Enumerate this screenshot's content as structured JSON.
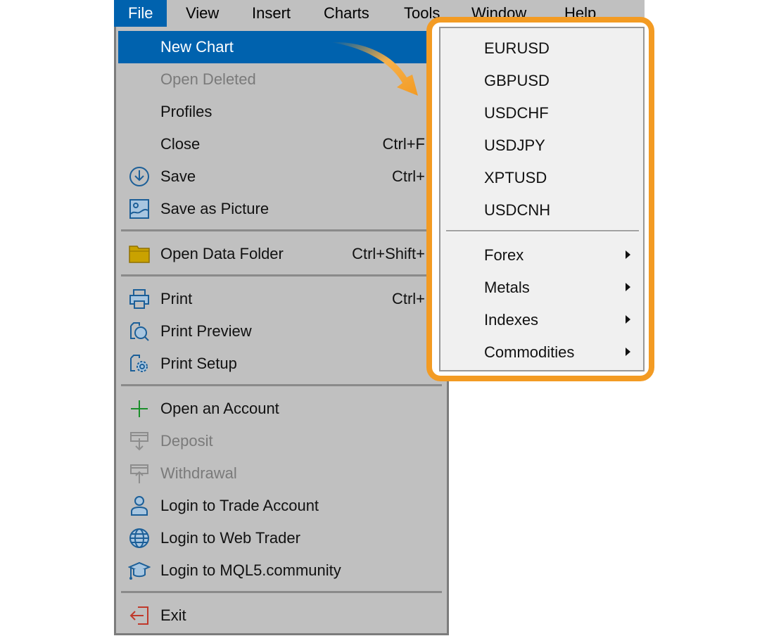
{
  "menubar": {
    "items": [
      {
        "label": "File",
        "active": true
      },
      {
        "label": "View"
      },
      {
        "label": "Insert"
      },
      {
        "label": "Charts"
      },
      {
        "label": "Tools"
      },
      {
        "label": "Window"
      },
      {
        "label": "Help"
      }
    ]
  },
  "file_menu": {
    "items": [
      {
        "label": "New Chart",
        "icon": "none",
        "highlighted": true
      },
      {
        "label": "Open Deleted",
        "icon": "none",
        "disabled": true
      },
      {
        "label": "Profiles",
        "icon": "none"
      },
      {
        "label": "Close",
        "icon": "none",
        "shortcut": "Ctrl+F"
      },
      {
        "label": "Save",
        "icon": "save-icon",
        "shortcut": "Ctrl+"
      },
      {
        "label": "Save as Picture",
        "icon": "picture-icon"
      },
      {
        "label": "Open Data Folder",
        "icon": "folder-icon",
        "shortcut": "Ctrl+Shift+"
      },
      {
        "label": "Print",
        "icon": "printer-icon",
        "shortcut": "Ctrl+"
      },
      {
        "label": "Print Preview",
        "icon": "print-preview-icon"
      },
      {
        "label": "Print Setup",
        "icon": "print-setup-icon"
      },
      {
        "label": "Open an Account",
        "icon": "plus-icon"
      },
      {
        "label": "Deposit",
        "icon": "deposit-icon",
        "disabled": true
      },
      {
        "label": "Withdrawal",
        "icon": "withdrawal-icon",
        "disabled": true
      },
      {
        "label": "Login to Trade Account",
        "icon": "user-icon"
      },
      {
        "label": "Login to Web Trader",
        "icon": "globe-icon"
      },
      {
        "label": "Login to MQL5.community",
        "icon": "graduation-cap-icon"
      },
      {
        "label": "Exit",
        "icon": "exit-icon"
      }
    ]
  },
  "new_chart_submenu": {
    "symbols": [
      "EURUSD",
      "GBPUSD",
      "USDCHF",
      "USDJPY",
      "XPTUSD",
      "USDCNH"
    ],
    "groups": [
      "Forex",
      "Metals",
      "Indexes",
      "Commodities"
    ]
  },
  "colors": {
    "highlight": "#0062ae",
    "menu_bg": "#c0c0c0",
    "submenu_bg": "#f0f0f0",
    "annotation": "#f39b23",
    "icon_blue": "#1c5f98",
    "plus_green": "#1a8f2a",
    "exit_red": "#c0392b"
  }
}
